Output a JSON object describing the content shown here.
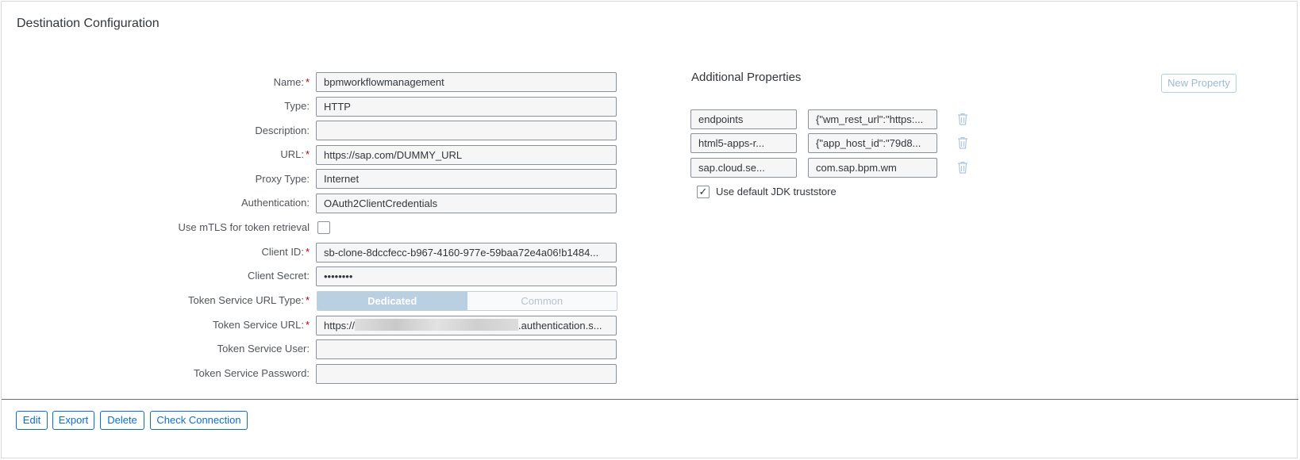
{
  "title": "Destination Configuration",
  "form": {
    "name": {
      "label": "Name:",
      "value": "bpmworkflowmanagement",
      "required": true
    },
    "type": {
      "label": "Type:",
      "value": "HTTP"
    },
    "description": {
      "label": "Description:",
      "value": ""
    },
    "url": {
      "label": "URL:",
      "value": "https://sap.com/DUMMY_URL",
      "required": true
    },
    "proxy_type": {
      "label": "Proxy Type:",
      "value": "Internet"
    },
    "authentication": {
      "label": "Authentication:",
      "value": "OAuth2ClientCredentials"
    },
    "mtls": {
      "label": "Use mTLS for token retrieval",
      "checked": false
    },
    "client_id": {
      "label": "Client ID:",
      "value": "sb-clone-8dccfecc-b967-4160-977e-59baa72e4a06!b1484...",
      "required": true
    },
    "client_secret": {
      "label": "Client Secret:",
      "value": "••••••••"
    },
    "token_url_type": {
      "label": "Token Service URL Type:",
      "required": true,
      "options": [
        "Dedicated",
        "Common"
      ],
      "selected": "Dedicated"
    },
    "token_url": {
      "label": "Token Service URL:",
      "value_prefix": "https://",
      "value_suffix": ".authentication.s...",
      "required": true
    },
    "token_user": {
      "label": "Token Service User:",
      "value": ""
    },
    "token_password": {
      "label": "Token Service Password:",
      "value": ""
    }
  },
  "additional": {
    "title": "Additional Properties",
    "new_property_label": "New Property",
    "properties": [
      {
        "key": "endpoints",
        "value": "{\"wm_rest_url\":\"https:..."
      },
      {
        "key": "html5-apps-r...",
        "value": "{\"app_host_id\":\"79d8..."
      },
      {
        "key": "sap.cloud.se...",
        "value": "com.sap.bpm.wm"
      }
    ],
    "jdk_truststore": {
      "label": "Use default JDK truststore",
      "checked": true,
      "check_glyph": "✓"
    }
  },
  "footer": {
    "edit": "Edit",
    "export": "Export",
    "delete": "Delete",
    "check_connection": "Check Connection"
  },
  "required_marker": "*",
  "colors": {
    "accent": "#0a6ed1",
    "required": "#bb0000",
    "segment_active": "#b9cfe2"
  },
  "icons": {
    "trash": "trash-icon",
    "checkmark": "checkmark-icon"
  }
}
